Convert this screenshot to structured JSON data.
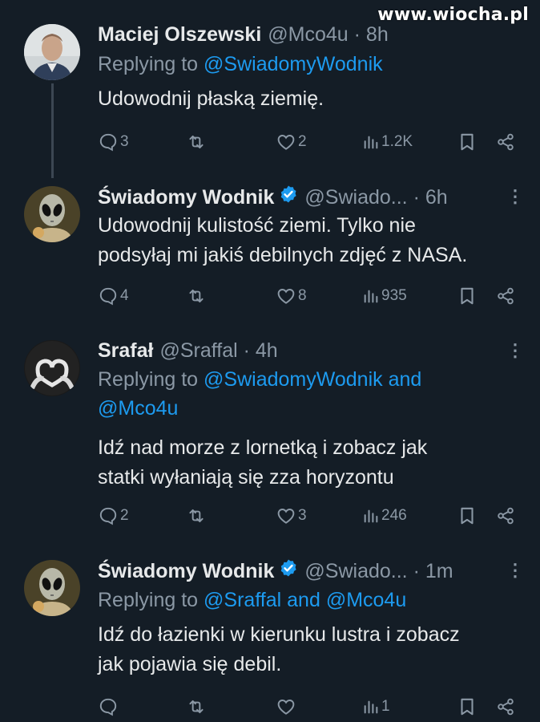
{
  "watermark": "www.wiocha.pl",
  "tweets": [
    {
      "name": "Maciej Olszewski",
      "handle": "@Mco4u · 8h",
      "verified": false,
      "replying_prefix": "Replying to ",
      "replying_to": "@SwiadomyWodnik",
      "text": [
        "Udowodnij płaską ziemię."
      ],
      "replies": "3",
      "retweets": "",
      "likes": "2",
      "views": "1.2K"
    },
    {
      "name": "Świadomy Wodnik",
      "handle": "@Swiado... · 6h",
      "verified": true,
      "text": [
        "Udowodnij kulistość ziemi. Tylko nie",
        "podsyłaj mi jakiś debilnych zdjęć z NASA."
      ],
      "replies": "4",
      "retweets": "",
      "likes": "8",
      "views": "935"
    },
    {
      "name": "Srafał",
      "handle": "@Sraffal · 4h",
      "verified": false,
      "replying_prefix": "Replying to ",
      "replying_to": "@SwiadomyWodnik and",
      "replying_to_2": "@Mco4u",
      "text": [
        "Idź nad morze z lornetką i zobacz jak",
        "statki wyłaniają się zza horyzontu"
      ],
      "replies": "2",
      "retweets": "",
      "likes": "3",
      "views": "246"
    },
    {
      "name": "Świadomy Wodnik",
      "handle": "@Swiado... · 1m",
      "verified": true,
      "replying_prefix": "Replying to ",
      "replying_to": "@Sraffal and @Mco4u",
      "text": [
        "Idź do łazienki w kierunku lustra i zobacz",
        "jak pojawia się debil."
      ],
      "replies": "",
      "retweets": "",
      "likes": "",
      "views": "1"
    }
  ],
  "colors": {
    "background": "#141d26",
    "text": "#e7e9ea",
    "secondary": "#8b98a5",
    "link": "#1d9bf0",
    "verified": "#1d9bf0"
  }
}
